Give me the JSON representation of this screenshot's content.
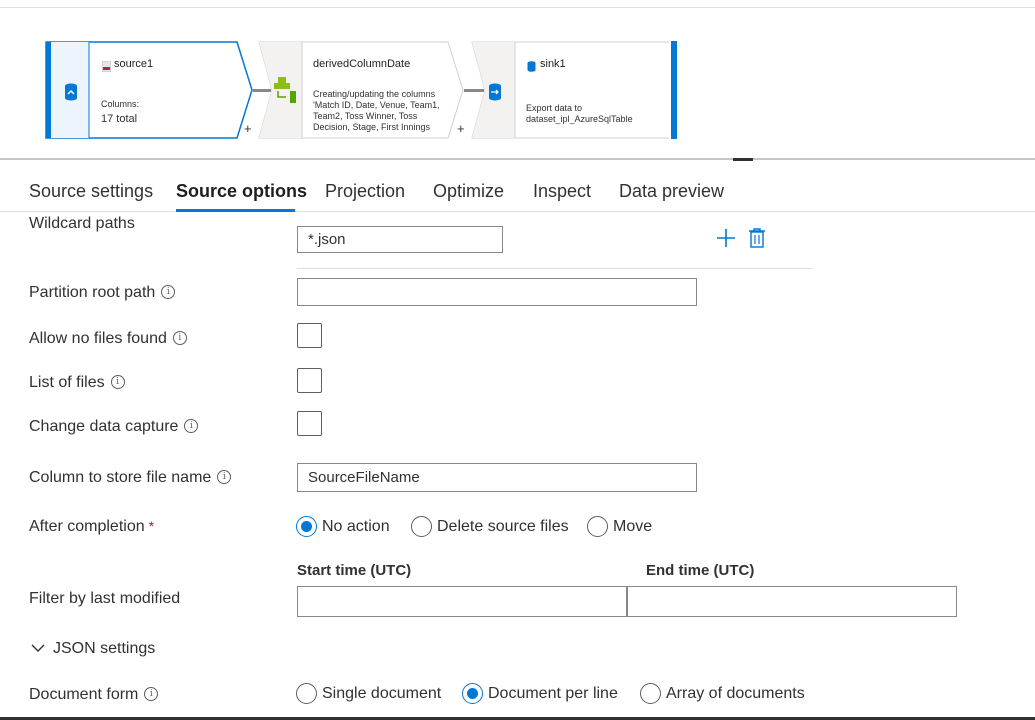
{
  "flow": {
    "source": {
      "name": "source1",
      "columns_label": "Columns:",
      "columns_value": "17 total"
    },
    "derived": {
      "name": "derivedColumnDate",
      "description": "Creating/updating the columns 'Match ID, Date, Venue, Team1, Team2, Toss Winner, Toss Decision, Stage, First Innings"
    },
    "sink": {
      "name": "sink1",
      "description": "Export data to dataset_ipl_AzureSqlTable"
    },
    "plus": "+"
  },
  "tabs": [
    {
      "label": "Source settings"
    },
    {
      "label": "Source options"
    },
    {
      "label": "Projection"
    },
    {
      "label": "Optimize"
    },
    {
      "label": "Inspect"
    },
    {
      "label": "Data preview"
    }
  ],
  "active_tab": "Source options",
  "form": {
    "wildcard_paths": {
      "label": "Wildcard paths",
      "value": "*.json"
    },
    "partition_root_path": {
      "label": "Partition root path",
      "value": ""
    },
    "allow_no_files_found": {
      "label": "Allow no files found",
      "checked": false
    },
    "list_of_files": {
      "label": "List of files",
      "checked": false
    },
    "change_data_capture": {
      "label": "Change data capture",
      "checked": false
    },
    "column_to_store_file_name": {
      "label": "Column to store file name",
      "value": "SourceFileName"
    },
    "after_completion": {
      "label": "After completion",
      "required_mark": "*",
      "options": [
        "No action",
        "Delete source files",
        "Move"
      ],
      "selected": "No action"
    },
    "filter_by_last_modified": {
      "label": "Filter by last modified",
      "start_label": "Start time (UTC)",
      "end_label": "End time (UTC)",
      "start_value": "",
      "end_value": ""
    },
    "json_settings": {
      "label": "JSON settings",
      "expanded": true
    },
    "document_form": {
      "label": "Document form",
      "options": [
        "Single document",
        "Document per line",
        "Array of documents"
      ],
      "selected": "Document per line"
    }
  },
  "icons": {
    "info": "info-icon",
    "add": "plus-icon",
    "delete": "trash-icon",
    "chevron": "chevron-down-icon"
  },
  "colors": {
    "accent": "#0078d4",
    "required": "#a4262c"
  }
}
